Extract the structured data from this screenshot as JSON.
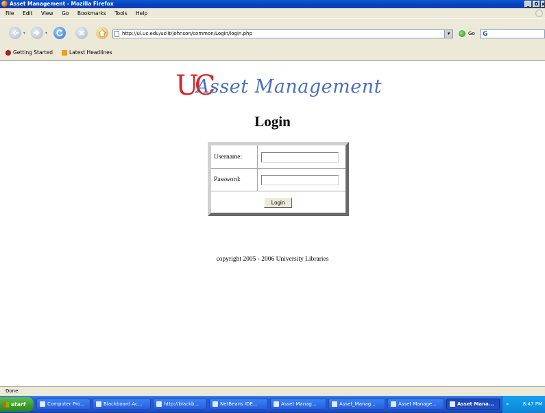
{
  "window": {
    "title": "Asset Management - Mozilla Firefox",
    "controls": [
      "_",
      "Ő",
      "x"
    ]
  },
  "menu": [
    "File",
    "Edit",
    "View",
    "Go",
    "Bookmarks",
    "Tools",
    "Help"
  ],
  "navigation": {
    "url": "http://ul.uc.edu/uclit/johnson/common/Login/login.php",
    "go_label": "Go",
    "search_glyph": "G"
  },
  "bookmarks": [
    {
      "label": "Getting Started"
    },
    {
      "label": "Latest Headlines"
    }
  ],
  "page": {
    "logo_mark": "UC",
    "logo_text": "Asset Management",
    "title": "Login",
    "form": {
      "username_label": "Username:",
      "password_label": "Password:",
      "username_value": "",
      "password_value": "",
      "submit_label": "Login"
    },
    "copyright": "copyright 2005 - 2006 University Libraries"
  },
  "status": "Done",
  "taskbar": {
    "start_label": "start",
    "tasks": [
      {
        "label": "Computer Pro..."
      },
      {
        "label": "Blackboard Ac..."
      },
      {
        "label": "http://blackb..."
      },
      {
        "label": "NetBeans IDE..."
      },
      {
        "label": "Asset Manag..."
      },
      {
        "label": "Asset_Manag..."
      },
      {
        "label": "Asset Manage..."
      },
      {
        "label": "Asset Mana..."
      }
    ],
    "chevron": "«",
    "clock": "8:47 PM"
  },
  "colors": {
    "logo_red": "#d72525",
    "logo_blue": "#4b6fbf",
    "titlebar_blue": "#0a4fcc"
  }
}
